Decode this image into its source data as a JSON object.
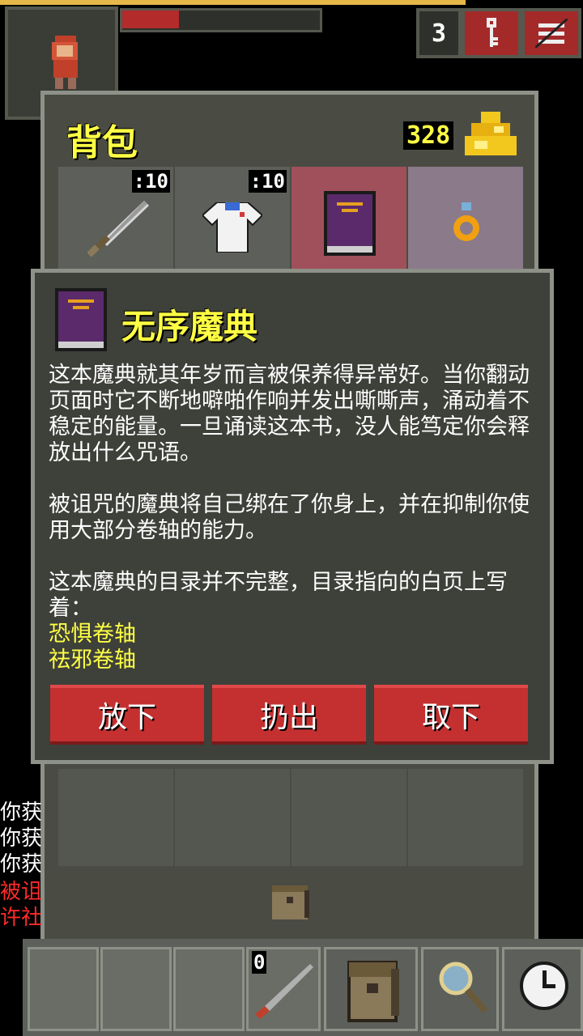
{
  "hud": {
    "depth": "3",
    "key_icon": "key-icon",
    "menu_icon": "menu-icon"
  },
  "backpack": {
    "title": "背包",
    "gold": "328",
    "items": [
      {
        "name": "sword",
        "count": ":10"
      },
      {
        "name": "cloth-armor",
        "count": ":10"
      },
      {
        "name": "grimoire",
        "count": ""
      },
      {
        "name": "ring",
        "count": ""
      }
    ]
  },
  "item": {
    "name": "无序魔典",
    "desc1": "这本魔典就其年岁而言被保养得异常好。当你翻动页面时它不断地噼啪作响并发出嘶嘶声，涌动着不稳定的能量。一旦诵读这本书，没人能笃定你会释放出什么咒语。",
    "desc2": "被诅咒的魔典将自己绑在了你身上，并在抑制你使用大部分卷轴的能力。",
    "desc3": "这本魔典的目录并不完整，目录指向的白页上写着：",
    "scroll1": "恐惧卷轴",
    "scroll2": "祛邪卷轴",
    "buttons": [
      "放下",
      "扔出",
      "取下"
    ]
  },
  "log": [
    "你获",
    "你获",
    "你获",
    "被诅",
    "许社"
  ],
  "quickslot": {
    "count": "0"
  },
  "colors": {
    "panel": "#4a4c44",
    "button": "#c43030",
    "highlight": "#ffff44"
  }
}
